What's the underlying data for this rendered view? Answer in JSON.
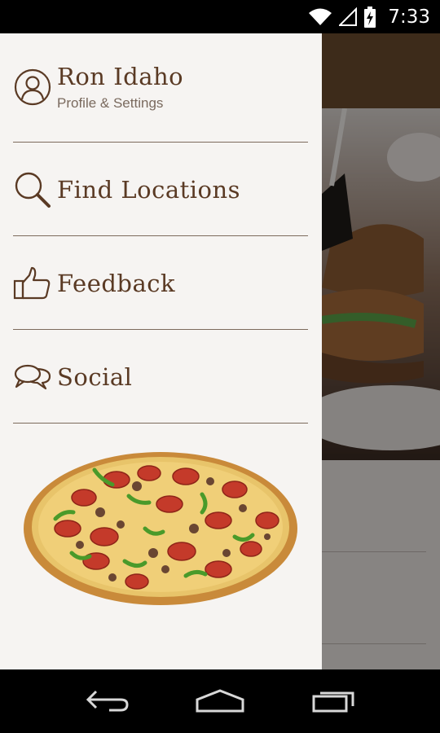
{
  "status_bar": {
    "time": "7:33",
    "icons": [
      "wifi-icon",
      "signal-icon",
      "battery-charging-icon"
    ]
  },
  "drawer": {
    "profile": {
      "name": "Ron Idaho",
      "subtitle": "Profile & Settings",
      "icon": "user-icon"
    },
    "items": [
      {
        "label": "Find Locations",
        "icon": "search-icon"
      },
      {
        "label": "Feedback",
        "icon": "thumbs-up-icon"
      },
      {
        "label": "Social",
        "icon": "chat-bubbles-icon"
      }
    ],
    "image": "pizza-image"
  },
  "nav_bar": {
    "buttons": [
      "back-icon",
      "home-icon",
      "recent-apps-icon"
    ]
  },
  "colors": {
    "accent_brown": "#5a3a24",
    "drawer_bg": "#f6f4f2",
    "header_brown": "#6a4a2e"
  }
}
